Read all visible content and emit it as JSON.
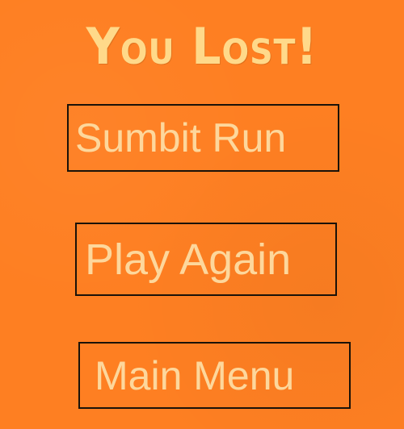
{
  "screen": {
    "title": "You Lost!",
    "background_color": "#fe7f22",
    "text_color": "#fdd79c"
  },
  "buttons": {
    "submit_run": "Sumbit Run",
    "play_again": "Play Again",
    "main_menu": "Main Menu"
  }
}
